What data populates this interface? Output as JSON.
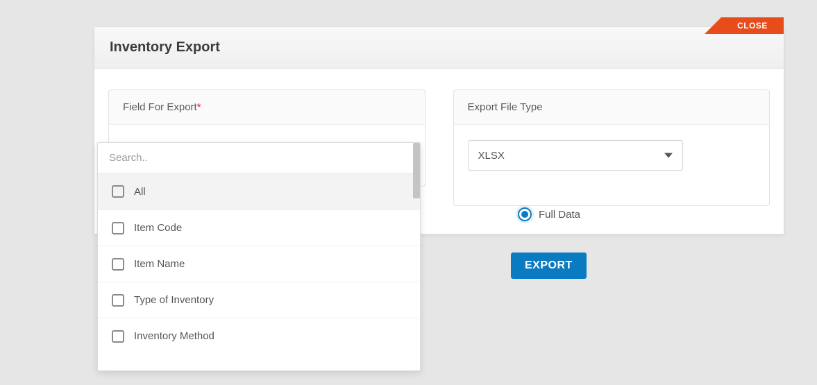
{
  "close_label": "CLOSE",
  "modal": {
    "title": "Inventory Export"
  },
  "panels": {
    "field_for_export": {
      "title": "Field For Export",
      "required_mark": "*"
    },
    "export_file_type": {
      "title": "Export File Type",
      "selected": "XLSX"
    }
  },
  "radio": {
    "full_data_label": "Full Data"
  },
  "export_button_label": "EXPORT",
  "dropdown": {
    "search_placeholder": "Search..",
    "items": [
      {
        "label": "All"
      },
      {
        "label": "Item Code"
      },
      {
        "label": "Item Name"
      },
      {
        "label": "Type of Inventory"
      },
      {
        "label": "Inventory Method"
      }
    ]
  }
}
